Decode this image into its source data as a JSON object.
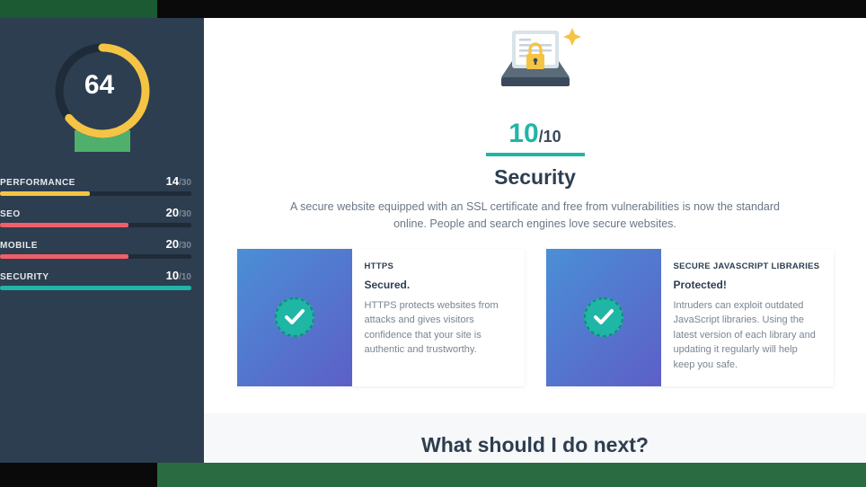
{
  "sidebar": {
    "overall_score": "64",
    "metrics": [
      {
        "label": "PERFORMANCE",
        "score": "14",
        "max": "/30",
        "pct": 47,
        "color": "#f5c444"
      },
      {
        "label": "SEO",
        "score": "20",
        "max": "/30",
        "pct": 67,
        "color": "#f05f6a"
      },
      {
        "label": "MOBILE",
        "score": "20",
        "max": "/30",
        "pct": 67,
        "color": "#f05f6a"
      },
      {
        "label": "SECURITY",
        "score": "10",
        "max": "/10",
        "pct": 100,
        "color": "#1fb6a6"
      }
    ]
  },
  "security": {
    "score_value": "10",
    "score_max": "/10",
    "title": "Security",
    "description": "A secure website equipped with an SSL certificate and free from vulnerabilities is now the standard online. People and search engines love secure websites.",
    "cards": [
      {
        "category": "HTTPS",
        "status": "Secured.",
        "text": "HTTPS protects websites from attacks and gives visitors confidence that your site is authentic and trustworthy."
      },
      {
        "category": "SECURE JAVASCRIPT LIBRARIES",
        "status": "Protected!",
        "text": "Intruders can exploit outdated JavaScript libraries. Using the latest version of each library and updating it regularly will help keep you safe."
      }
    ]
  },
  "next": {
    "title": "What should I do next?"
  },
  "colors": {
    "teal": "#1fb6a6",
    "green": "#4fb06d"
  }
}
